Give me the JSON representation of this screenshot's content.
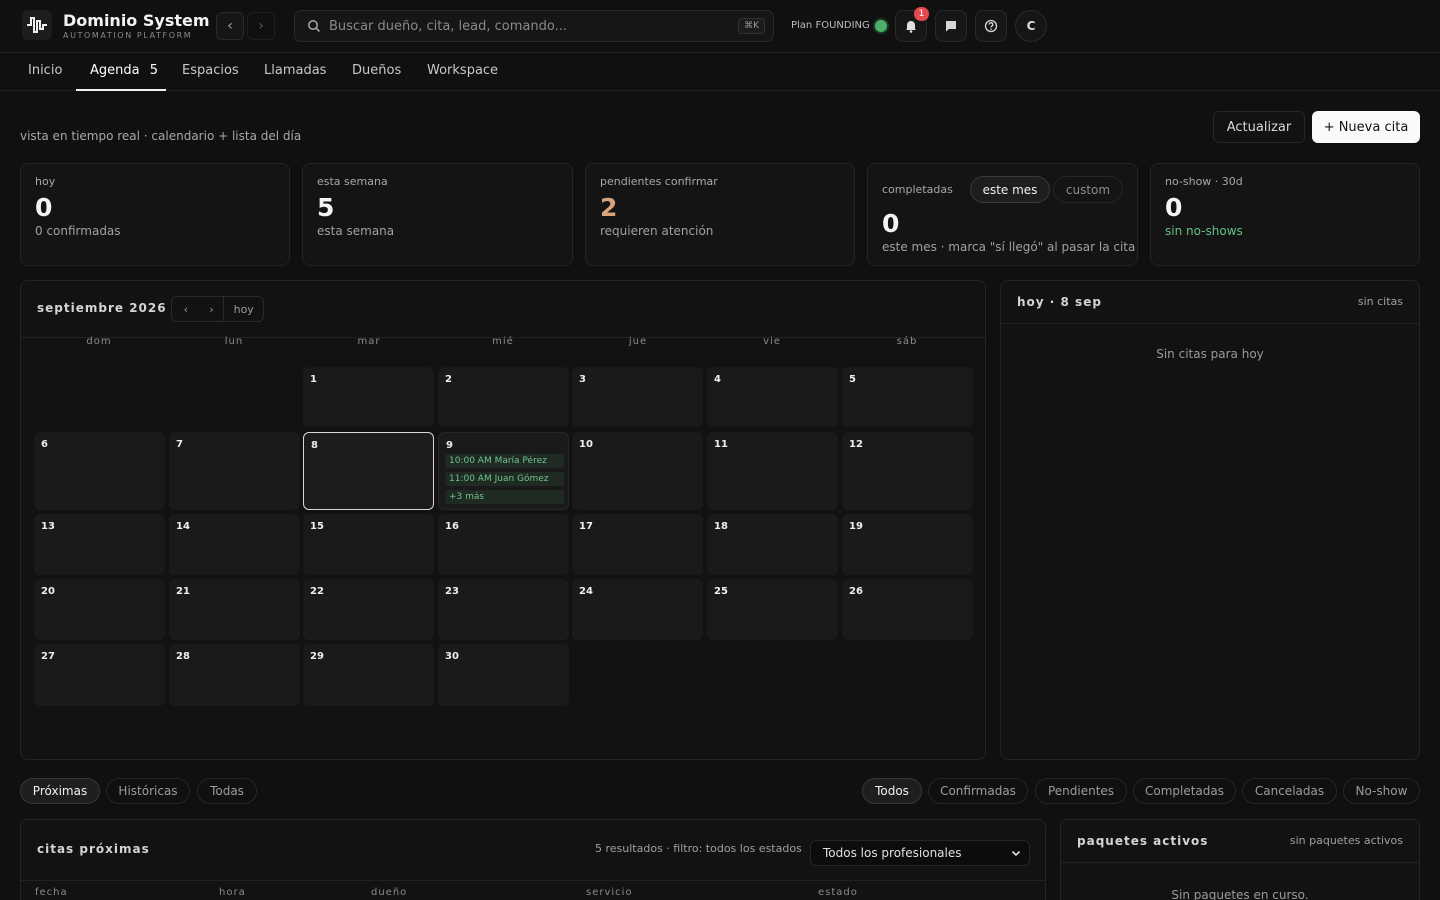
{
  "brand": {
    "name": "Dominio System",
    "subtitle": "AUTOMATION PLATFORM"
  },
  "search": {
    "placeholder": "Buscar dueño, cita, lead, comando...",
    "shortcut": "⌘K"
  },
  "plan": {
    "label": "Plan FOUNDING",
    "status_color": "#4caf6a"
  },
  "notifications": {
    "count": "1"
  },
  "user": {
    "initial": "C"
  },
  "tabs": [
    {
      "label": "Inicio"
    },
    {
      "label": "Agenda",
      "count": "5"
    },
    {
      "label": "Espacios"
    },
    {
      "label": "Llamadas"
    },
    {
      "label": "Dueños"
    },
    {
      "label": "Workspace"
    }
  ],
  "page": {
    "subtitle": "vista en tiempo real · calendario + lista del día",
    "refresh_label": "Actualizar",
    "new_label": "+ Nueva cita"
  },
  "stats": {
    "today": {
      "label": "hoy",
      "value": "0",
      "desc": "0 confirmadas"
    },
    "week": {
      "label": "esta semana",
      "value": "5",
      "desc": "esta semana"
    },
    "pending": {
      "label": "pendientes confirmar",
      "value": "2",
      "desc": "requieren atención"
    },
    "completed": {
      "label": "completadas",
      "value": "0",
      "desc": "este mes · marca \"sí llegó\" al pasar la cita",
      "toggle_on": "este mes",
      "toggle_off": "custom"
    },
    "noshow": {
      "label": "no-show · 30d",
      "value": "0",
      "desc": "sin no-shows"
    }
  },
  "calendar": {
    "month": "septiembre 2026",
    "today_label": "hoy",
    "weekdays": [
      "dom",
      "lun",
      "mar",
      "mié",
      "jue",
      "vie",
      "sáb"
    ],
    "days": [
      "1",
      "2",
      "3",
      "4",
      "5",
      "6",
      "7",
      "8",
      "9",
      "10",
      "11",
      "12",
      "13",
      "14",
      "15",
      "16",
      "17",
      "18",
      "19",
      "20",
      "21",
      "22",
      "23",
      "24",
      "25",
      "26",
      "27",
      "28",
      "29",
      "30"
    ],
    "events_day9": [
      "10:00 AM María Pérez",
      "11:00 AM Juan Gómez",
      "+3 más"
    ]
  },
  "today_panel": {
    "title": "hoy · 8 sep",
    "meta": "sin citas",
    "empty": "Sin citas para hoy"
  },
  "time_filters": [
    "Próximas",
    "Históricas",
    "Todas"
  ],
  "status_filters": [
    "Todos",
    "Confirmadas",
    "Pendientes",
    "Completadas",
    "Canceladas",
    "No-show"
  ],
  "appointments": {
    "title": "citas próximas",
    "meta": "5 resultados · filtro: todos los estados",
    "select_value": "Todos los profesionales",
    "columns": [
      "fecha",
      "hora",
      "dueño",
      "servicio",
      "estado"
    ]
  },
  "packages": {
    "title": "paquetes activos",
    "meta": "sin paquetes activos",
    "empty": "Sin paquetes en curso."
  }
}
